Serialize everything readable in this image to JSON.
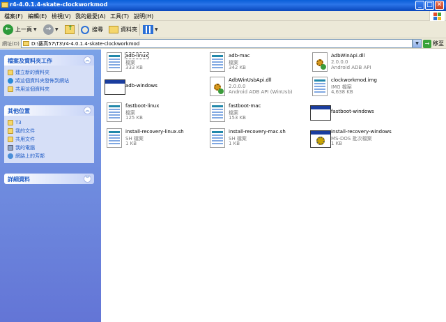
{
  "window": {
    "title": "r4-4.0.1.4-skate-clockworkmod",
    "min_glyph": "_",
    "max_glyph": "□",
    "close_glyph": "✕"
  },
  "menu": [
    "檔案(F)",
    "編輯(E)",
    "檢視(V)",
    "我的最愛(A)",
    "工具(T)",
    "說明(H)"
  ],
  "toolbar": {
    "back_label": "上一頁",
    "search_label": "搜尋",
    "folders_label": "資料夾"
  },
  "address": {
    "label": "網址(D)",
    "path": "D:\\藝高57\\T3\\r4-4.0.1.4-skate-clockworkmod",
    "go_label": "移至"
  },
  "sidebar": {
    "tasks": {
      "title": "檔案及資料夾工作",
      "items": [
        "建立新的資料夾",
        "將這個資料夾發佈到網站",
        "共用這個資料夾"
      ]
    },
    "places": {
      "title": "其他位置",
      "items": [
        "T3",
        "我的文件",
        "共用文件",
        "我的電腦",
        "網路上的芳鄰"
      ]
    },
    "details": {
      "title": "詳細資料"
    }
  },
  "files": [
    {
      "name": "adb-linux",
      "type": "檔案",
      "size": "333 KB",
      "icon": "generic-file-icon"
    },
    {
      "name": "adb-mac",
      "type": "檔案",
      "size": "342 KB",
      "icon": "generic-file-icon"
    },
    {
      "name": "AdbWinApi.dll",
      "type": "2.0.0.0",
      "size": "Android ADB API",
      "icon": "dll-icon"
    },
    {
      "name": "adb-windows",
      "type": "",
      "size": "",
      "icon": "application-window-icon"
    },
    {
      "name": "AdbWinUsbApi.dll",
      "type": "2.0.0.0",
      "size": "Android ADB API (WinUsb)",
      "icon": "dll-icon"
    },
    {
      "name": "clockworkmod.img",
      "type": "IMG 檔案",
      "size": "4,638 KB",
      "icon": "generic-file-icon"
    },
    {
      "name": "fastboot-linux",
      "type": "檔案",
      "size": "125 KB",
      "icon": "generic-file-icon"
    },
    {
      "name": "fastboot-mac",
      "type": "檔案",
      "size": "153 KB",
      "icon": "generic-file-icon"
    },
    {
      "name": "fastboot-windows",
      "type": "",
      "size": "",
      "icon": "application-window-icon"
    },
    {
      "name": "install-recovery-linux.sh",
      "type": "SH 檔案",
      "size": "1 KB",
      "icon": "generic-file-icon"
    },
    {
      "name": "install-recovery-mac.sh",
      "type": "SH 檔案",
      "size": "1 KB",
      "icon": "generic-file-icon"
    },
    {
      "name": "install-recovery-windows",
      "type": "MS-DOS 批次檔案",
      "size": "1 KB",
      "icon": "batch-file-icon"
    }
  ]
}
